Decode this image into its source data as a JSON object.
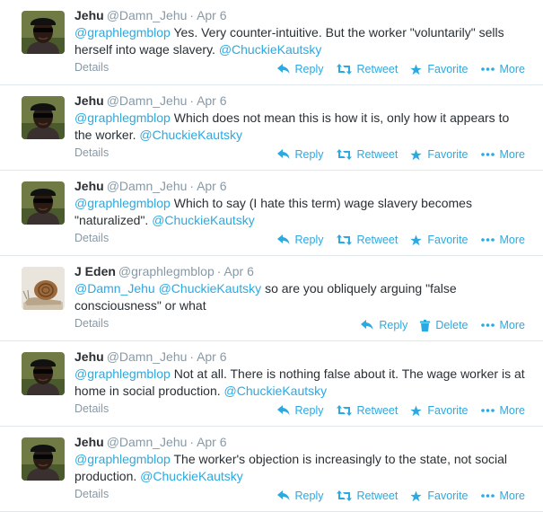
{
  "colors": {
    "accent": "#2ba9e1",
    "muted": "#8899a6",
    "text": "#292f33",
    "divider": "#e1e8ed"
  },
  "tweets": [
    {
      "name": "Jehu",
      "handle": "@Damn_Jehu",
      "date": "Apr 6",
      "avatar": "jehu",
      "segments": [
        {
          "type": "mention",
          "text": "@graphlegmblop"
        },
        {
          "type": "text",
          "text": " Yes. Very counter-intuitive. But the worker \"voluntarily\" sells herself into wage slavery. "
        },
        {
          "type": "mention",
          "text": "@ChuckieKautsky"
        }
      ],
      "details": "Details",
      "actions": [
        {
          "icon": "reply-icon",
          "label": "Reply"
        },
        {
          "icon": "retweet-icon",
          "label": "Retweet"
        },
        {
          "icon": "star-icon",
          "label": "Favorite"
        },
        {
          "icon": "more-icon",
          "label": "More"
        }
      ]
    },
    {
      "name": "Jehu",
      "handle": "@Damn_Jehu",
      "date": "Apr 6",
      "avatar": "jehu",
      "segments": [
        {
          "type": "mention",
          "text": "@graphlegmblop"
        },
        {
          "type": "text",
          "text": " Which does not mean this is how it is, only how it appears to the worker. "
        },
        {
          "type": "mention",
          "text": "@ChuckieKautsky"
        }
      ],
      "details": "Details",
      "actions": [
        {
          "icon": "reply-icon",
          "label": "Reply"
        },
        {
          "icon": "retweet-icon",
          "label": "Retweet"
        },
        {
          "icon": "star-icon",
          "label": "Favorite"
        },
        {
          "icon": "more-icon",
          "label": "More"
        }
      ]
    },
    {
      "name": "Jehu",
      "handle": "@Damn_Jehu",
      "date": "Apr 6",
      "avatar": "jehu",
      "segments": [
        {
          "type": "mention",
          "text": "@graphlegmblop"
        },
        {
          "type": "text",
          "text": " Which to say (I hate this term) wage slavery becomes \"naturalized\". "
        },
        {
          "type": "mention",
          "text": "@ChuckieKautsky"
        }
      ],
      "details": "Details",
      "actions": [
        {
          "icon": "reply-icon",
          "label": "Reply"
        },
        {
          "icon": "retweet-icon",
          "label": "Retweet"
        },
        {
          "icon": "star-icon",
          "label": "Favorite"
        },
        {
          "icon": "more-icon",
          "label": "More"
        }
      ]
    },
    {
      "name": "J Eden",
      "handle": "@graphlegmblop",
      "date": "Apr 6",
      "avatar": "snail",
      "segments": [
        {
          "type": "mention",
          "text": "@Damn_Jehu"
        },
        {
          "type": "text",
          "text": " "
        },
        {
          "type": "mention",
          "text": "@ChuckieKautsky"
        },
        {
          "type": "text",
          "text": " so are you obliquely arguing \"false consciousness\" or what"
        }
      ],
      "details": "Details",
      "actions": [
        {
          "icon": "reply-icon",
          "label": "Reply"
        },
        {
          "icon": "trash-icon",
          "label": "Delete"
        },
        {
          "icon": "more-icon",
          "label": "More"
        }
      ]
    },
    {
      "name": "Jehu",
      "handle": "@Damn_Jehu",
      "date": "Apr 6",
      "avatar": "jehu",
      "segments": [
        {
          "type": "mention",
          "text": "@graphlegmblop"
        },
        {
          "type": "text",
          "text": " Not at all. There is nothing false about it. The wage worker is at home in social production. "
        },
        {
          "type": "mention",
          "text": "@ChuckieKautsky"
        }
      ],
      "details": "Details",
      "actions": [
        {
          "icon": "reply-icon",
          "label": "Reply"
        },
        {
          "icon": "retweet-icon",
          "label": "Retweet"
        },
        {
          "icon": "star-icon",
          "label": "Favorite"
        },
        {
          "icon": "more-icon",
          "label": "More"
        }
      ]
    },
    {
      "name": "Jehu",
      "handle": "@Damn_Jehu",
      "date": "Apr 6",
      "avatar": "jehu",
      "segments": [
        {
          "type": "mention",
          "text": "@graphlegmblop"
        },
        {
          "type": "text",
          "text": " The worker's objection is increasingly to the state, not social production. "
        },
        {
          "type": "mention",
          "text": "@ChuckieKautsky"
        }
      ],
      "details": "Details",
      "actions": [
        {
          "icon": "reply-icon",
          "label": "Reply"
        },
        {
          "icon": "retweet-icon",
          "label": "Retweet"
        },
        {
          "icon": "star-icon",
          "label": "Favorite"
        },
        {
          "icon": "more-icon",
          "label": "More"
        }
      ]
    }
  ]
}
